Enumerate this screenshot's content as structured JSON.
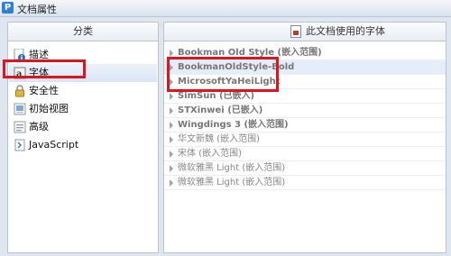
{
  "window": {
    "title": "文档属性",
    "logo_letter": "P"
  },
  "left_panel": {
    "header": "分类",
    "items": [
      {
        "label": "描述",
        "icon": "info-icon"
      },
      {
        "label": "字体",
        "icon": "font-icon",
        "selected": true
      },
      {
        "label": "安全性",
        "icon": "lock-icon"
      },
      {
        "label": "初始视图",
        "icon": "initial-view-icon"
      },
      {
        "label": "高级",
        "icon": "advanced-icon"
      },
      {
        "label": "JavaScript",
        "icon": "javascript-icon"
      }
    ]
  },
  "right_panel": {
    "header": "此文档使用的字体",
    "fonts": [
      {
        "label": "Bookman Old Style (嵌入范围)",
        "bold": true
      },
      {
        "label": "BookmanOldStyle-Bold",
        "bold": true,
        "selected": true
      },
      {
        "label": "MicrosoftYaHeiLight",
        "bold": true
      },
      {
        "label": "SimSun (已嵌入)",
        "bold": true
      },
      {
        "label": "STXinwei (已嵌入)",
        "bold": true
      },
      {
        "label": "Wingdings 3 (嵌入范围)",
        "bold": true
      },
      {
        "label": "华文新魏 (嵌入范围)",
        "bold": false
      },
      {
        "label": "宋体 (嵌入范围)",
        "bold": false
      },
      {
        "label": "微软雅黑 Light (嵌入范围)",
        "bold": false
      },
      {
        "label": "微软雅黑 Light (嵌入范围)",
        "bold": false
      }
    ]
  },
  "colors": {
    "highlight": "#e0141c",
    "selection": "#e4edf9"
  }
}
